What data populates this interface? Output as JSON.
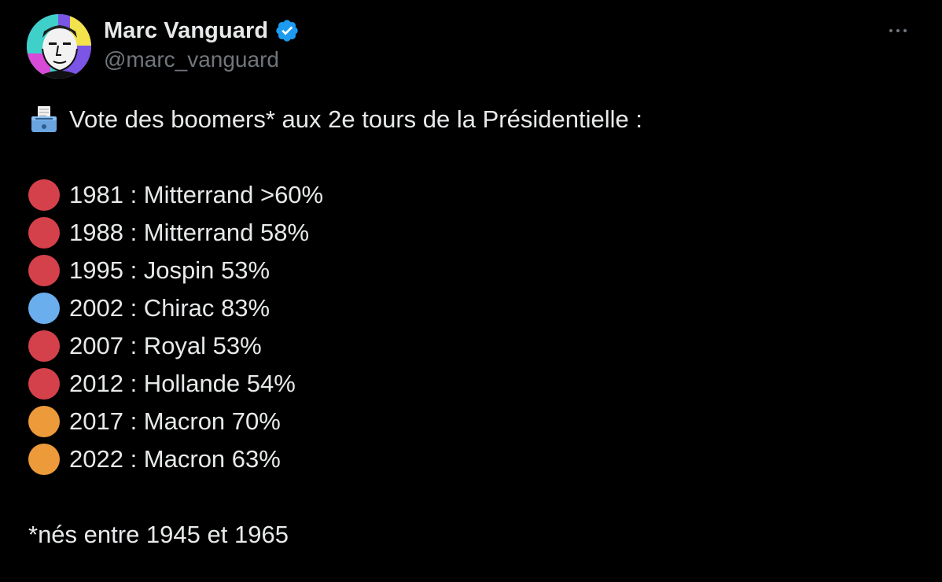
{
  "author": {
    "display_name": "Marc Vanguard",
    "handle": "@marc_vanguard",
    "verified_icon": "verified-badge-icon",
    "avatar_icon": "avatar-portrait"
  },
  "more_icon": "more-options-icon",
  "tweet": {
    "title_icon": "ballot-box-icon",
    "title": "Vote des boomers* aux 2e tours de la Présidentielle :",
    "results": [
      {
        "text": "1981 : Mitterrand >60%",
        "color": "#d5414b"
      },
      {
        "text": "1988 : Mitterrand 58%",
        "color": "#d5414b"
      },
      {
        "text": "1995 : Jospin 53%",
        "color": "#d5414b"
      },
      {
        "text": "2002 : Chirac 83%",
        "color": "#6aaeee"
      },
      {
        "text": "2007 : Royal 53%",
        "color": "#d5414b"
      },
      {
        "text": "2012 : Hollande 54%",
        "color": "#d5414b"
      },
      {
        "text": "2017 : Macron 70%",
        "color": "#ec9a3a"
      },
      {
        "text": "2022 : Macron 63%",
        "color": "#ec9a3a"
      }
    ],
    "footnote": "*nés entre 1945 et 1965"
  },
  "colors": {
    "background": "#000000",
    "text": "#e7e9ea",
    "secondary_text": "#71767b",
    "verified_blue": "#1d9bf0"
  }
}
